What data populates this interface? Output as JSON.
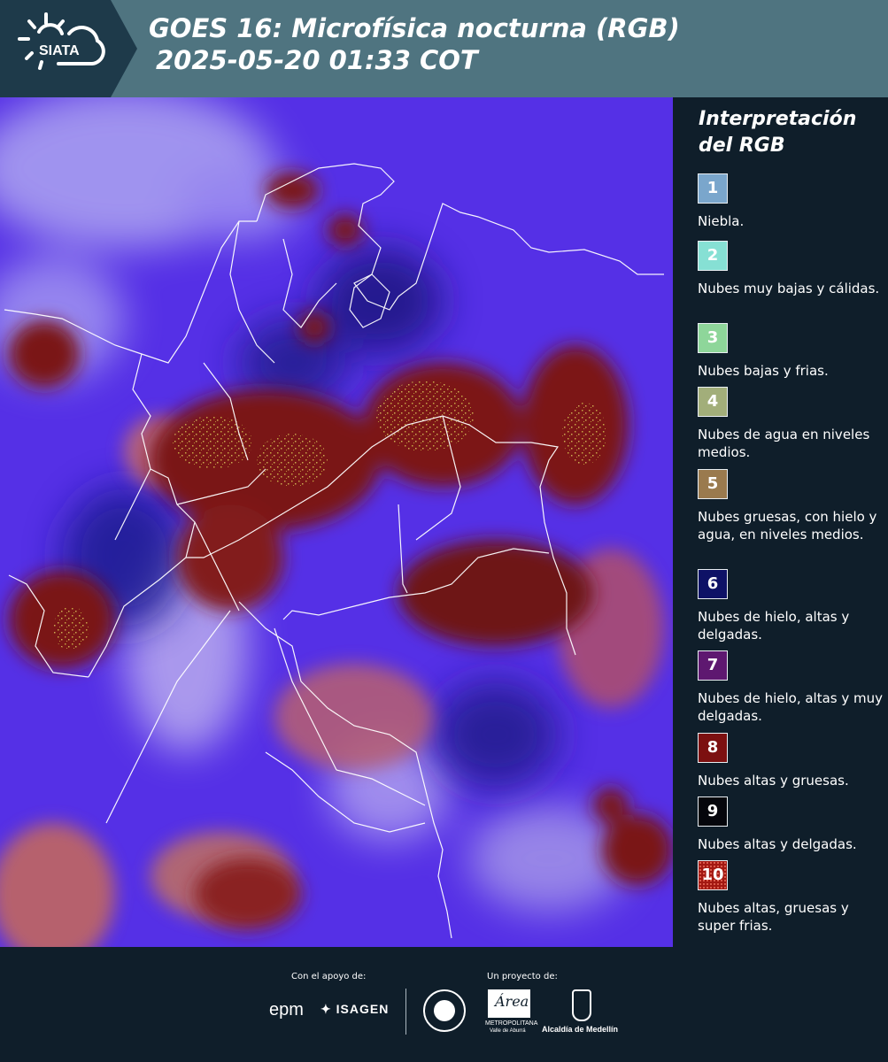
{
  "header": {
    "logo_text": "SIATA",
    "title_line1": "GOES 16: Microfísica nocturna (RGB)",
    "title_line2": "2025-05-20 01:33 COT"
  },
  "legend": {
    "title_line1": "Interpretación",
    "title_line2": "del RGB",
    "items": [
      {
        "num": "1",
        "text": "Niebla.",
        "color": "#7aa6cc"
      },
      {
        "num": "2",
        "text": "Nubes muy bajas y cálidas.",
        "color": "#86e0d4"
      },
      {
        "num": "3",
        "text": "Nubes bajas y frias.",
        "color": "#8ed69a"
      },
      {
        "num": "4",
        "text": "Nubes de agua en niveles medios.",
        "color": "#a2ae7a"
      },
      {
        "num": "5",
        "text": "Nubes gruesas, con hielo y agua, en niveles medios.",
        "color": "#9a7a4e"
      },
      {
        "num": "6",
        "text": "Nubes de hielo, altas y delgadas.",
        "color": "#0e1266"
      },
      {
        "num": "7",
        "text": "Nubes de hielo, altas y muy delgadas.",
        "color": "#5e1870"
      },
      {
        "num": "8",
        "text": "Nubes altas y gruesas.",
        "color": "#7c1010"
      },
      {
        "num": "9",
        "text": "Nubes altas y delgadas.",
        "color": "#05060c"
      },
      {
        "num": "10",
        "text": "Nubes altas, gruesas y super frias.",
        "color": "#a31812"
      }
    ]
  },
  "footer": {
    "support_caption": "Con el apoyo de:",
    "project_caption": "Un proyecto de:",
    "sponsor1": "epm",
    "sponsor2": "ISAGEN",
    "partner1": "METROPOLITANA",
    "partner1_sub": "Valle de Aburrá",
    "partner1_mark": "Área",
    "partner2": "Alcaldía de Medellín"
  }
}
